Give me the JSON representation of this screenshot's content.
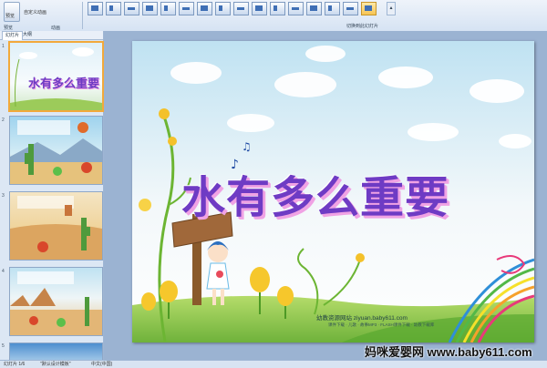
{
  "ribbon": {
    "labels": [
      "预览",
      "自定义动画"
    ],
    "groups": {
      "preview": "预览",
      "animation": "动画",
      "transition": "切换到此幻灯片"
    },
    "selected_transition": 15
  },
  "panel": {
    "tabs": [
      "幻灯片",
      "大纲"
    ],
    "slides": [
      {
        "num": "1",
        "caption": "水有多么重要"
      },
      {
        "num": "2",
        "caption": ""
      },
      {
        "num": "3",
        "caption": ""
      },
      {
        "num": "4",
        "caption": ""
      },
      {
        "num": "5",
        "caption": ""
      }
    ]
  },
  "slide": {
    "title": "水有多么重要",
    "site_line": "幼教资源网站  ziyuan.baby611.com",
    "site_sub": "课件下载 · 儿歌 · 故事MP3 · FLASH课件下载 · 幼教下载库"
  },
  "status": {
    "left": "幻灯片 1/6",
    "theme": "\"默认设计模板\"",
    "lang": "中文(中国)"
  },
  "watermark": "妈咪爱婴网 www.baby611.com",
  "colors": {
    "title": "#6e3bc4",
    "title_shadow": "#f0a2e4",
    "selection": "#f2a93b",
    "ribbon": "#d6e3f3"
  }
}
